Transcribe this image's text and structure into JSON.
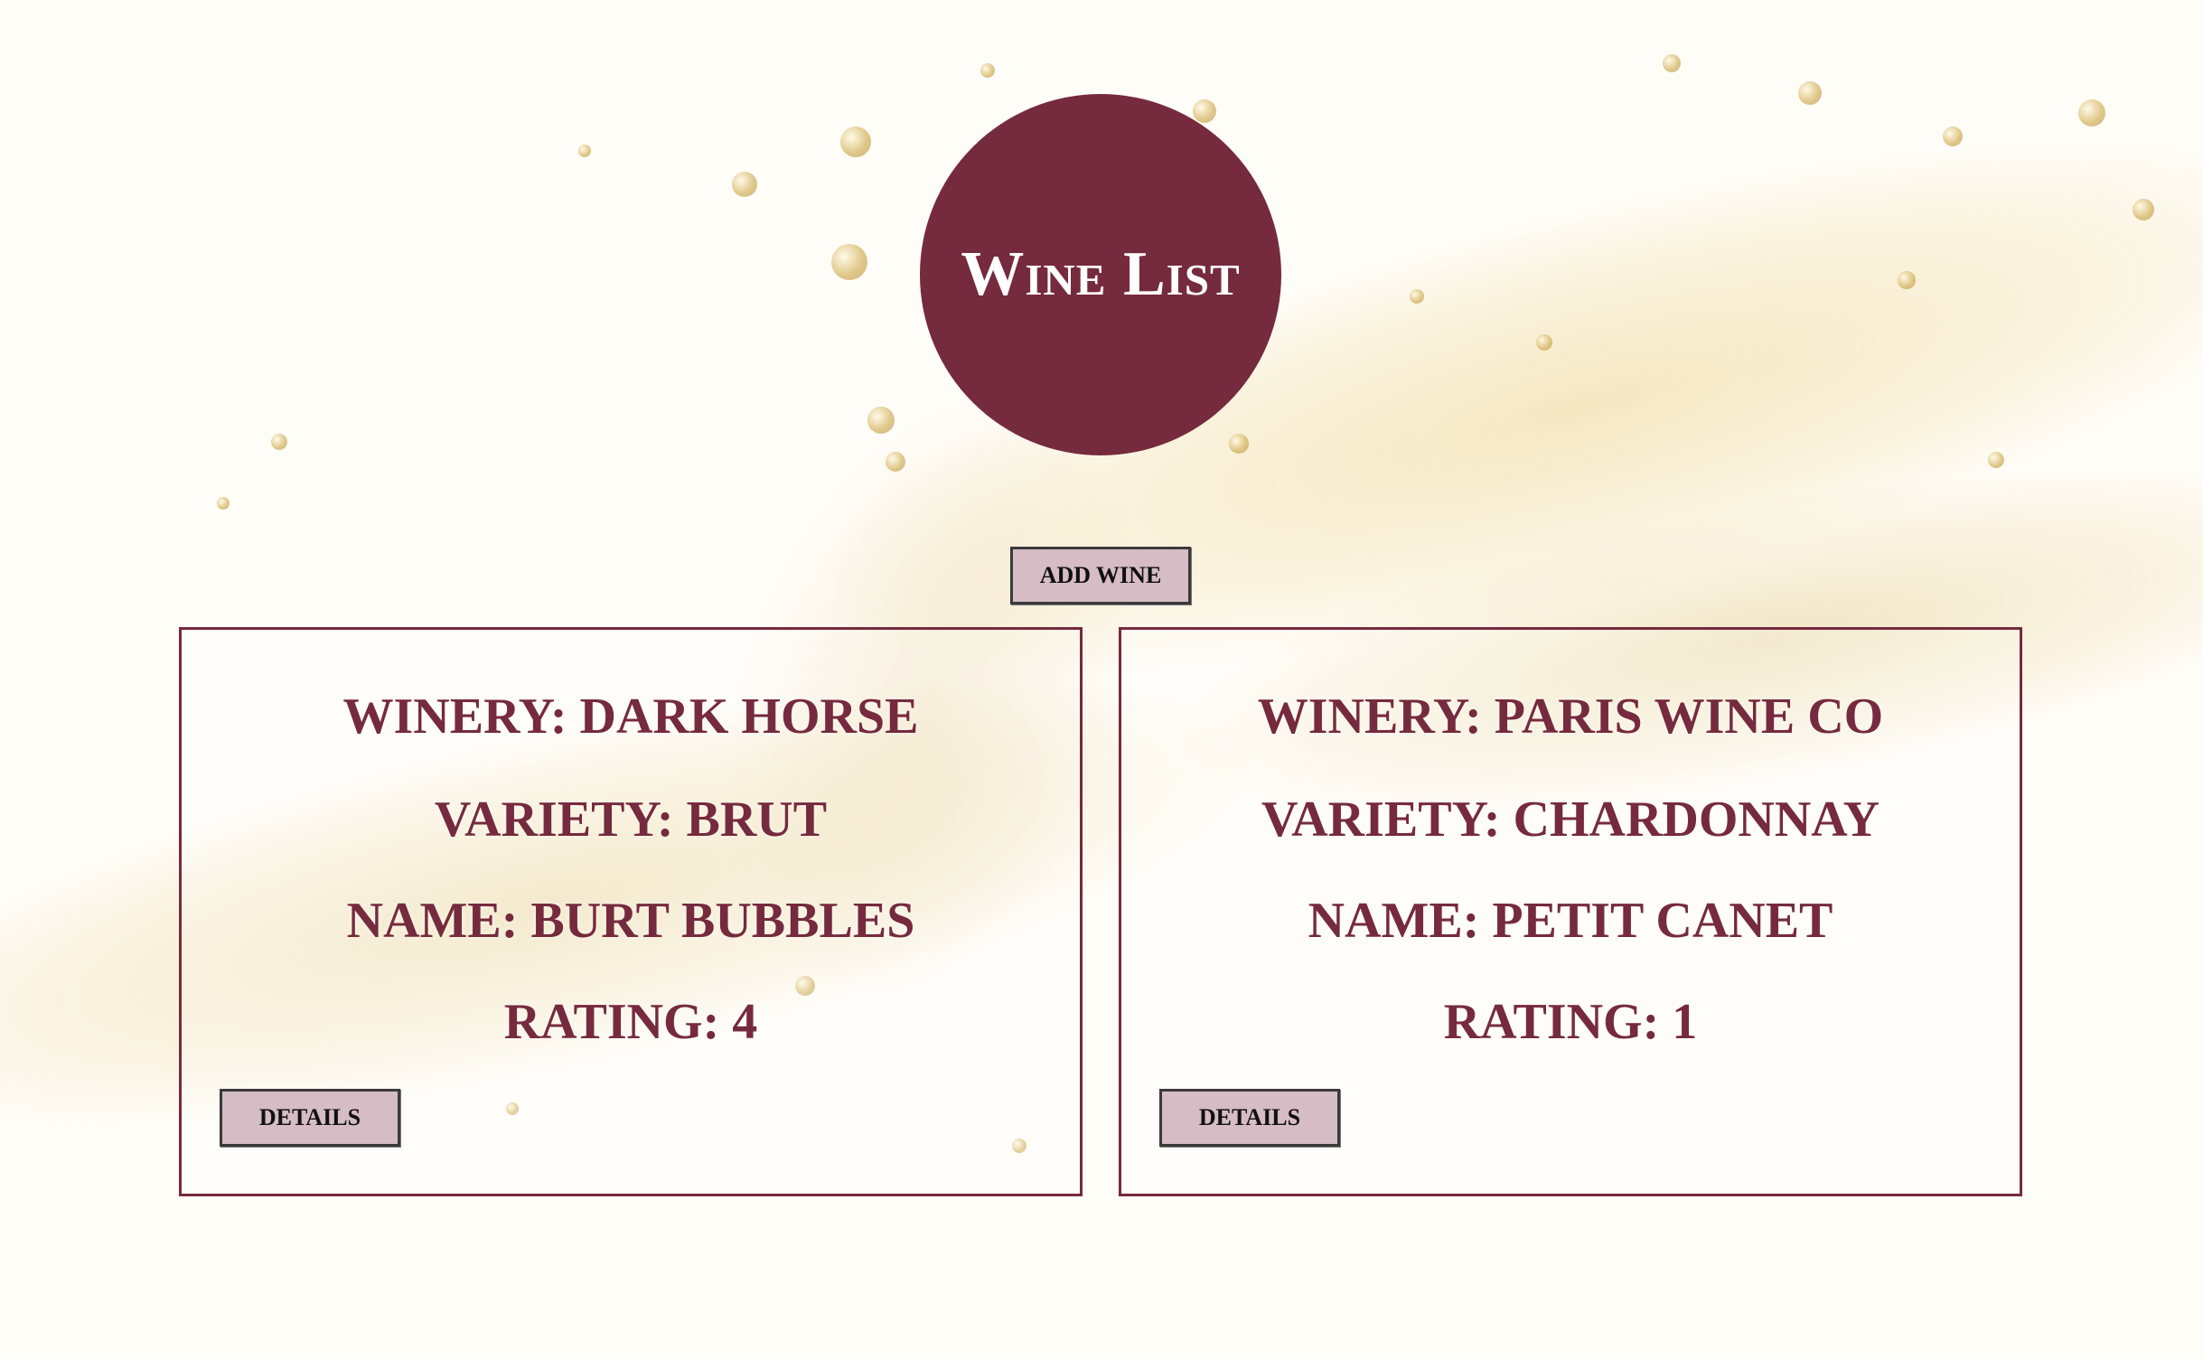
{
  "header": {
    "title": "Wine List",
    "add_button_label": "Add Wine"
  },
  "wines": [
    {
      "winery": "Winery: Dark Horse",
      "variety": "Variety: Brut",
      "name": "Name: Burt Bubbles",
      "rating": "Rating: 4",
      "details_label": "Details"
    },
    {
      "winery": "Winery: Paris Wine Co",
      "variety": "Variety: Chardonnay",
      "name": "Name: Petit Canet",
      "rating": "Rating: 1",
      "details_label": "Details"
    }
  ],
  "colors": {
    "accent": "#762a3e",
    "button_bg": "#d6bcc5",
    "splash": "#e8d39a"
  },
  "background": {
    "icon": "wine-splash-image"
  }
}
